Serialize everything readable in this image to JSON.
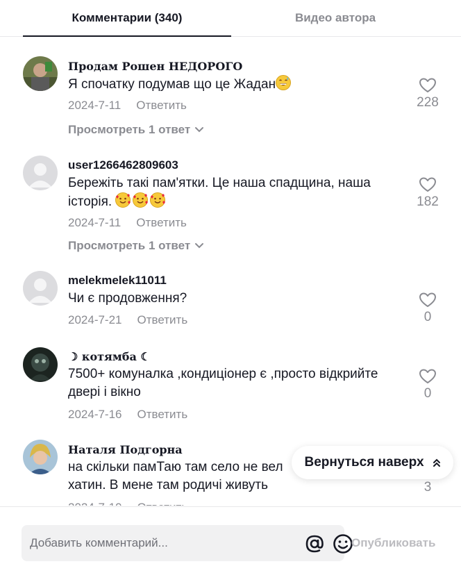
{
  "tabs": {
    "comments": "Комментарии (340)",
    "creator_videos": "Видео автора"
  },
  "comments": [
    {
      "author": "Продам Рошен НЕДОРОГО",
      "text": "Я спочатку подумав що це Жадан",
      "emoji": [
        "grinning-face-with-sweat"
      ],
      "date": "2024-7-11",
      "reply_label": "Ответить",
      "likes": "228",
      "replies_label": "Просмотреть 1 ответ"
    },
    {
      "author": "user1266462809603",
      "text": "Бережіть такі пам'ятки. Це наша спадщина, наша історія.",
      "emoji": [
        "smiling-face-with-hearts",
        "smiling-face-with-hearts",
        "smiling-face-with-hearts"
      ],
      "date": "2024-7-11",
      "reply_label": "Ответить",
      "likes": "182",
      "replies_label": "Просмотреть 1 ответ"
    },
    {
      "author": "melekmelek11011",
      "text": "Чи є продовження?",
      "date": "2024-7-21",
      "reply_label": "Ответить",
      "likes": "0"
    },
    {
      "author": "☽ котямба ☾",
      "text": "7500+ комуналка ,кондиціонер є ,просто відкрийте двері і вікно",
      "date": "2024-7-16",
      "reply_label": "Ответить",
      "likes": "0"
    },
    {
      "author": "Наталя Подгорна",
      "text": "на скільки памТаю там село не вел",
      "text_line2": "хатин. В мене там родичі живуть",
      "likes": "3"
    }
  ],
  "back_to_top": "Вернуться наверх",
  "composer": {
    "placeholder": "Добавить комментарий...",
    "publish_label": "Опубликовать"
  },
  "colors": {
    "primary_text": "#161823",
    "secondary_text": "#8a8b91",
    "disabled_text": "#bcbcc0",
    "input_bg": "#f1f1f2"
  }
}
